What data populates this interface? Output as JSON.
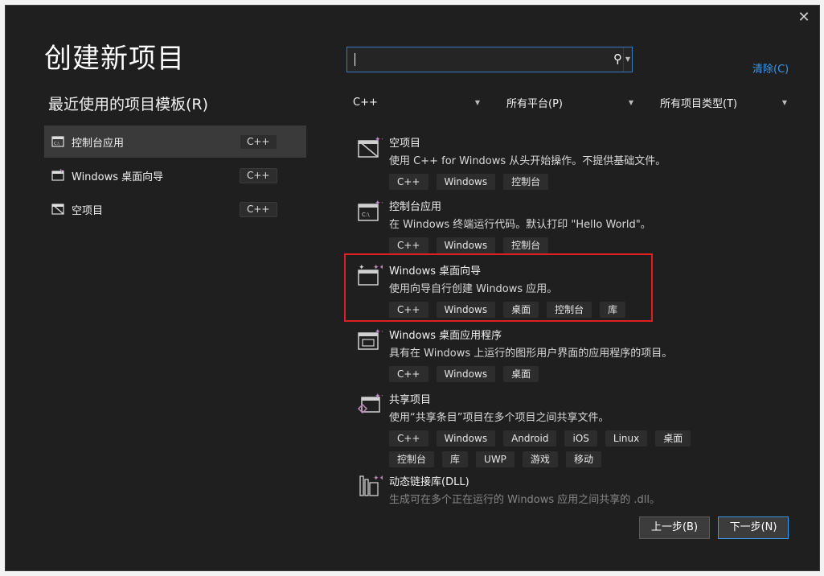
{
  "dialog": {
    "title": "创建新项目",
    "close_label": "✕"
  },
  "recent": {
    "heading": "最近使用的项目模板(R)",
    "items": [
      {
        "label": "控制台应用",
        "lang": "C++"
      },
      {
        "label": "Windows 桌面向导",
        "lang": "C++"
      },
      {
        "label": "空项目",
        "lang": "C++"
      }
    ]
  },
  "search": {
    "value": "",
    "placeholder": ""
  },
  "clear_label": "清除(C)",
  "filters": {
    "language": "C++",
    "platform": "所有平台(P)",
    "project_type": "所有项目类型(T)"
  },
  "templates": [
    {
      "name": "空项目",
      "desc": "使用 C++ for Windows 从头开始操作。不提供基础文件。",
      "tags": [
        "C++",
        "Windows",
        "控制台"
      ]
    },
    {
      "name": "控制台应用",
      "desc": "在 Windows 终端运行代码。默认打印 \"Hello World\"。",
      "tags": [
        "C++",
        "Windows",
        "控制台"
      ]
    },
    {
      "name": "Windows 桌面向导",
      "desc": "使用向导自行创建 Windows 应用。",
      "tags": [
        "C++",
        "Windows",
        "桌面",
        "控制台",
        "库"
      ]
    },
    {
      "name": "Windows 桌面应用程序",
      "desc": "具有在 Windows 上运行的图形用户界面的应用程序的项目。",
      "tags": [
        "C++",
        "Windows",
        "桌面"
      ]
    },
    {
      "name": "共享项目",
      "desc": "使用“共享条目”项目在多个项目之间共享文件。",
      "tags": [
        "C++",
        "Windows",
        "Android",
        "iOS",
        "Linux",
        "桌面",
        "控制台",
        "库",
        "UWP",
        "游戏",
        "移动"
      ]
    },
    {
      "name": "动态链接库(DLL)",
      "desc": "生成可在多个正在运行的 Windows 应用之间共享的 .dll。",
      "tags": []
    }
  ],
  "buttons": {
    "back": "上一步(B)",
    "next": "下一步(N)"
  },
  "colors": {
    "background": "#1f1f1f",
    "accent": "#3b97ea",
    "highlight": "#e02020"
  }
}
